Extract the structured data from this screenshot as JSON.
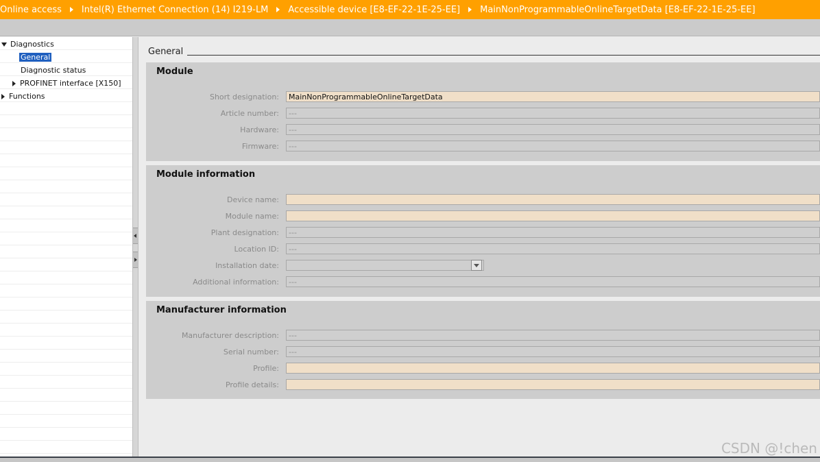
{
  "breadcrumb": [
    {
      "label": "Online access"
    },
    {
      "label": "Intel(R) Ethernet Connection (14) I219-LM"
    },
    {
      "label": "Accessible device [E8-EF-22-1E-25-EE]"
    },
    {
      "label": "MainNonProgrammableOnlineTargetData [E8-EF-22-1E-25-EE]"
    }
  ],
  "nav": {
    "diagnostics": "Diagnostics",
    "general": "General",
    "diagnostic_status": "Diagnostic status",
    "profinet": "PROFINET interface [X150]",
    "functions": "Functions"
  },
  "section_title": "General",
  "module": {
    "title": "Module",
    "short_designation_label": "Short designation:",
    "short_designation_value": "MainNonProgrammableOnlineTargetData",
    "article_number_label": "Article number:",
    "article_number_value": "---",
    "hardware_label": "Hardware:",
    "hardware_value": "---",
    "firmware_label": "Firmware:",
    "firmware_value": "---"
  },
  "module_info": {
    "title": "Module information",
    "device_name_label": "Device name:",
    "device_name_value": "",
    "module_name_label": "Module name:",
    "module_name_value": "",
    "plant_designation_label": "Plant designation:",
    "plant_designation_value": "---",
    "location_id_label": "Location ID:",
    "location_id_value": "---",
    "installation_date_label": "Installation date:",
    "installation_date_value": "",
    "additional_info_label": "Additional information:",
    "additional_info_value": "---"
  },
  "manufacturer_info": {
    "title": "Manufacturer information",
    "manufacturer_description_label": "Manufacturer description:",
    "manufacturer_description_value": "---",
    "serial_number_label": "Serial number:",
    "serial_number_value": "---",
    "profile_label": "Profile:",
    "profile_value": "",
    "profile_details_label": "Profile details:",
    "profile_details_value": ""
  },
  "watermark": "CSDN @!chen",
  "colors": {
    "title_bar": "#ffa000",
    "editable_field": "#f0dfc8",
    "selection": "#1f5fbf"
  }
}
